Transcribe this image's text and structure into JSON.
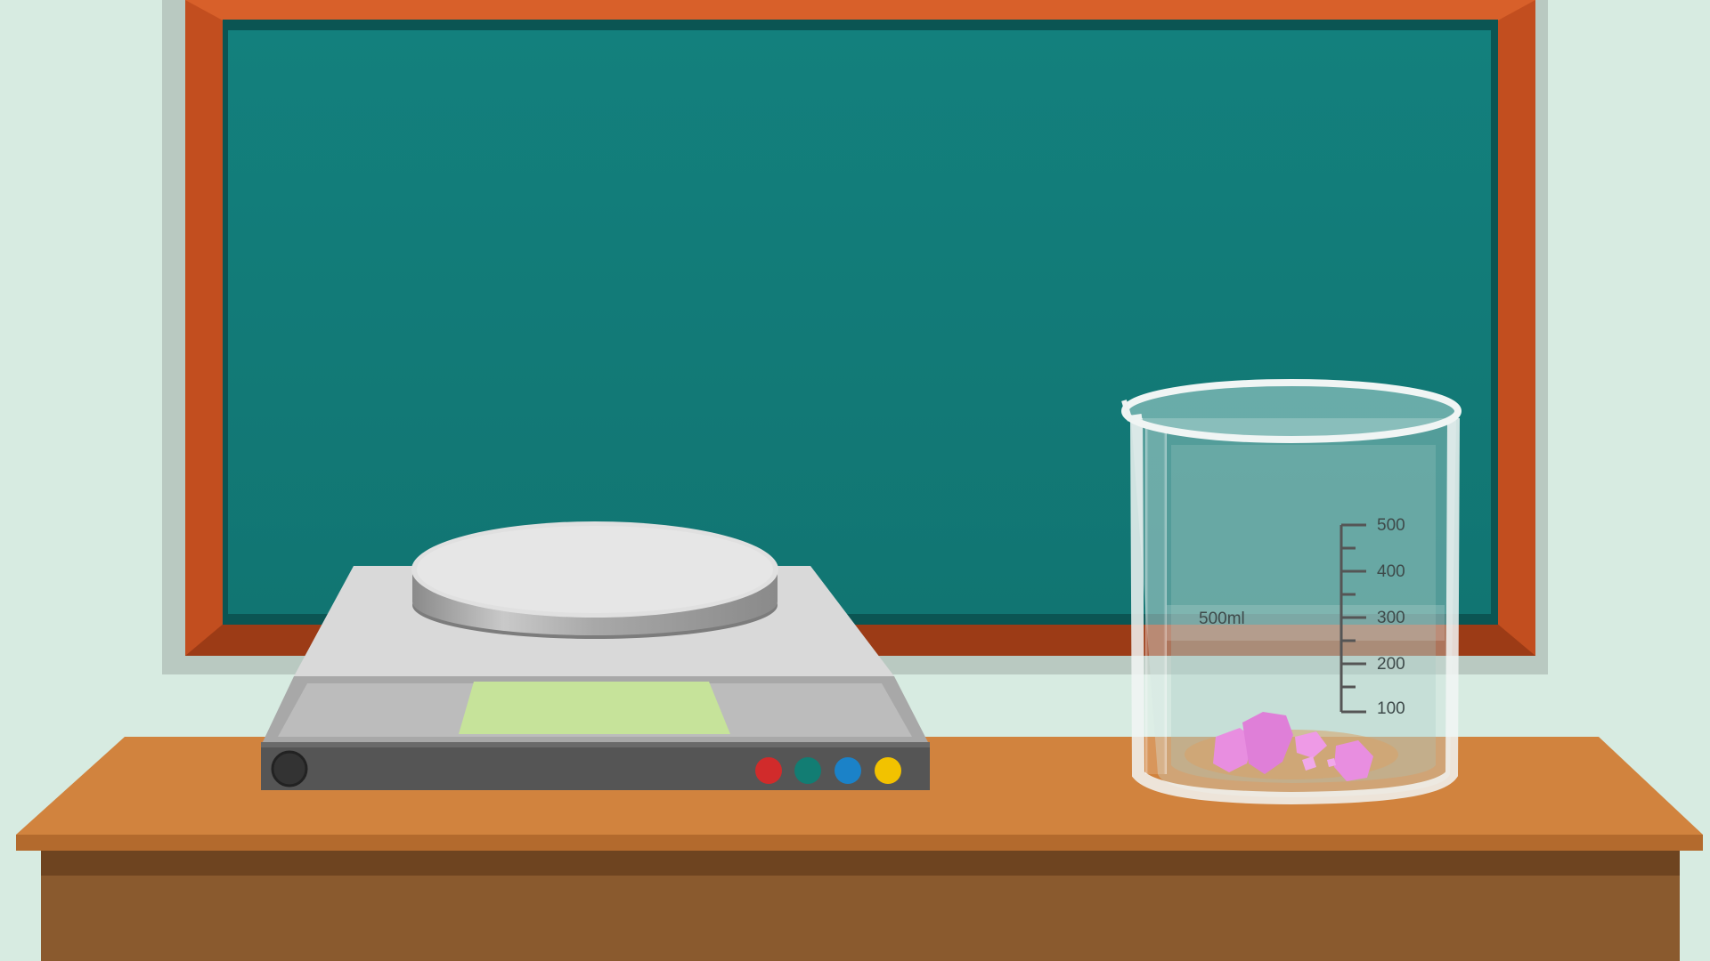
{
  "scene": {
    "description_elements": [
      "chalkboard",
      "lab-table",
      "digital-scale",
      "glass-beaker",
      "pink-crystals"
    ]
  },
  "colors": {
    "wall": "#d7ebe1",
    "board_frame": "#c24e1f",
    "board_surface": "#137f7c",
    "table_top": "#d1833e",
    "table_body": "#8a5a2e",
    "scale_body": "#dcdcdc",
    "scale_display": "#c6e39a",
    "crystals": "#e88ee0",
    "button_red": "#d12b2b",
    "button_teal": "#127d73",
    "button_blue": "#1b82c8",
    "button_yellow": "#f2c200"
  },
  "scale": {
    "display_text": "",
    "buttons": [
      {
        "name": "red",
        "color": "#d12b2b"
      },
      {
        "name": "teal",
        "color": "#127d73"
      },
      {
        "name": "blue",
        "color": "#1b82c8"
      },
      {
        "name": "yellow",
        "color": "#f2c200"
      }
    ]
  },
  "beaker": {
    "capacity_label": "500ml",
    "graduations": [
      "500",
      "400",
      "300",
      "200",
      "100"
    ]
  },
  "icons": {
    "power": "power-button-icon"
  }
}
